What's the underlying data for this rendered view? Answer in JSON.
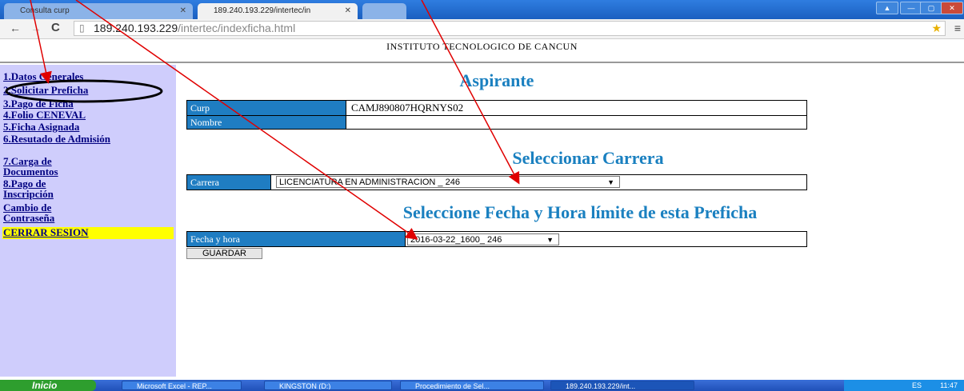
{
  "browser": {
    "tabs": [
      {
        "title": "Consulta curp"
      },
      {
        "title": "189.240.193.229/intertec/in"
      }
    ],
    "url_host": "189.240.193.229",
    "url_path": "/intertec/indexficha.html"
  },
  "page": {
    "institution": "INSTITUTO TECNOLOGICO DE CANCUN",
    "sidebar": {
      "items": [
        {
          "label": "1.Datos Generales"
        },
        {
          "label": "2.Solicitar Preficha"
        },
        {
          "label": "3.Pago de Ficha"
        },
        {
          "label": "4.Folio CENEVAL"
        },
        {
          "label": "5.Ficha Asignada"
        },
        {
          "label": "6.Resutado de Admisión"
        },
        {
          "label": "7.Carga de Documentos"
        },
        {
          "label": "8.Pago de Inscripción"
        },
        {
          "label": "Cambio de Contraseña"
        }
      ],
      "logout": "CERRAR SESION"
    },
    "aspirante": {
      "heading": "Aspirante",
      "curp_label": "Curp",
      "curp_value": "CAMJ890807HQRNYS02",
      "nombre_label": "Nombre",
      "nombre_value": ""
    },
    "carrera": {
      "heading": "Seleccionar Carrera",
      "label": "Carrera",
      "selected": "LICENCIATURA EN ADMINISTRACION _ 246"
    },
    "fecha": {
      "heading": "Seleccione Fecha y Hora límite de esta Preficha",
      "label": "Fecha y hora",
      "selected": "2016-03-22_1600_ 246"
    },
    "save_button": "GUARDAR"
  },
  "taskbar": {
    "start": "Inicio",
    "items": [
      {
        "label": "Microsoft Excel - REP..."
      },
      {
        "label": "KINGSTON (D:)"
      },
      {
        "label": "Procedimiento de Sel..."
      },
      {
        "label": "189.240.193.229/int..."
      }
    ],
    "lang": "ES",
    "clock": "11:47"
  },
  "colors": {
    "accent": "#1a80c0",
    "label_bg": "#1f7dc2",
    "sidebar_bg": "#cfcdfc",
    "annotation": "#e00000"
  }
}
